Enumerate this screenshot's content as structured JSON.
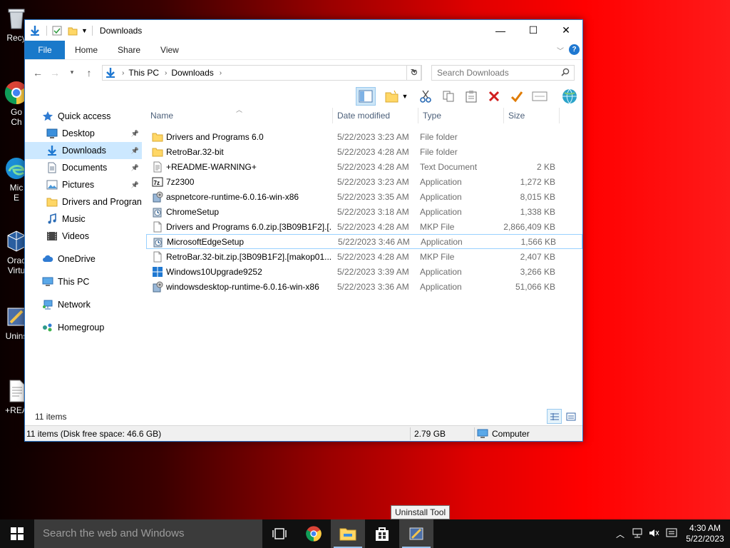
{
  "desktop": {
    "icons": [
      {
        "label": "Recy"
      },
      {
        "label": "Go\nCh"
      },
      {
        "label": "Mic\nE"
      },
      {
        "label": "Orac\nVirtu"
      },
      {
        "label": "Unins"
      },
      {
        "label": "+REA"
      }
    ]
  },
  "window": {
    "title": "Downloads",
    "ribbon_tabs": [
      "File",
      "Home",
      "Share",
      "View"
    ],
    "help": "?",
    "address": {
      "segments": [
        "This PC",
        "Downloads"
      ]
    },
    "search": {
      "placeholder": "Search Downloads"
    }
  },
  "nav": {
    "items": [
      {
        "label": "Quick access",
        "icon": "star-icon"
      },
      {
        "label": "Desktop",
        "icon": "desktop-icon",
        "pinned": true
      },
      {
        "label": "Downloads",
        "icon": "download-icon",
        "pinned": true,
        "selected": true
      },
      {
        "label": "Documents",
        "icon": "documents-icon",
        "pinned": true
      },
      {
        "label": "Pictures",
        "icon": "pictures-icon",
        "pinned": true
      },
      {
        "label": "Drivers and Progran",
        "icon": "folder-icon"
      },
      {
        "label": "Music",
        "icon": "music-icon"
      },
      {
        "label": "Videos",
        "icon": "videos-icon"
      },
      {
        "label": "OneDrive",
        "icon": "cloud-icon"
      },
      {
        "label": "This PC",
        "icon": "computer-icon"
      },
      {
        "label": "Network",
        "icon": "network-icon"
      },
      {
        "label": "Homegroup",
        "icon": "homegroup-icon"
      }
    ]
  },
  "columns": {
    "name": "Name",
    "date": "Date modified",
    "type": "Type",
    "size": "Size"
  },
  "files": [
    {
      "name": "Drivers and Programs 6.0",
      "date": "5/22/2023 3:23 AM",
      "type": "File folder",
      "size": "",
      "icon": "folder"
    },
    {
      "name": "RetroBar.32-bit",
      "date": "5/22/2023 4:28 AM",
      "type": "File folder",
      "size": "",
      "icon": "folder"
    },
    {
      "name": "+README-WARNING+",
      "date": "5/22/2023 4:28 AM",
      "type": "Text Document",
      "size": "2 KB",
      "icon": "text"
    },
    {
      "name": "7z2300",
      "date": "5/22/2023 3:23 AM",
      "type": "Application",
      "size": "1,272 KB",
      "icon": "7z"
    },
    {
      "name": "aspnetcore-runtime-6.0.16-win-x86",
      "date": "5/22/2023 3:35 AM",
      "type": "Application",
      "size": "8,015 KB",
      "icon": "installer"
    },
    {
      "name": "ChromeSetup",
      "date": "5/22/2023 3:18 AM",
      "type": "Application",
      "size": "1,338 KB",
      "icon": "setup"
    },
    {
      "name": "Drivers and Programs 6.0.zip.[3B09B1F2].[...",
      "date": "5/22/2023 4:28 AM",
      "type": "MKP File",
      "size": "2,866,409 KB",
      "icon": "blank"
    },
    {
      "name": "MicrosoftEdgeSetup",
      "date": "5/22/2023 3:46 AM",
      "type": "Application",
      "size": "1,566 KB",
      "icon": "setup",
      "selected": true
    },
    {
      "name": "RetroBar.32-bit.zip.[3B09B1F2].[makop01...",
      "date": "5/22/2023 4:28 AM",
      "type": "MKP File",
      "size": "2,407 KB",
      "icon": "blank"
    },
    {
      "name": "Windows10Upgrade9252",
      "date": "5/22/2023 3:39 AM",
      "type": "Application",
      "size": "3,266 KB",
      "icon": "windows"
    },
    {
      "name": "windowsdesktop-runtime-6.0.16-win-x86",
      "date": "5/22/2023 3:36 AM",
      "type": "Application",
      "size": "51,066 KB",
      "icon": "installer"
    }
  ],
  "status": {
    "item_count": "11 items",
    "bar_left": "11 items (Disk free space: 46.6 GB)",
    "bar_size": "2.79 GB",
    "bar_location": "Computer"
  },
  "tooltip": "Uninstall Tool",
  "taskbar": {
    "search_placeholder": "Search the web and Windows",
    "time": "4:30 AM",
    "date": "5/22/2023"
  },
  "colors": {
    "accent": "#1979ca",
    "selection": "#cce8ff",
    "folder": "#ffd766"
  }
}
